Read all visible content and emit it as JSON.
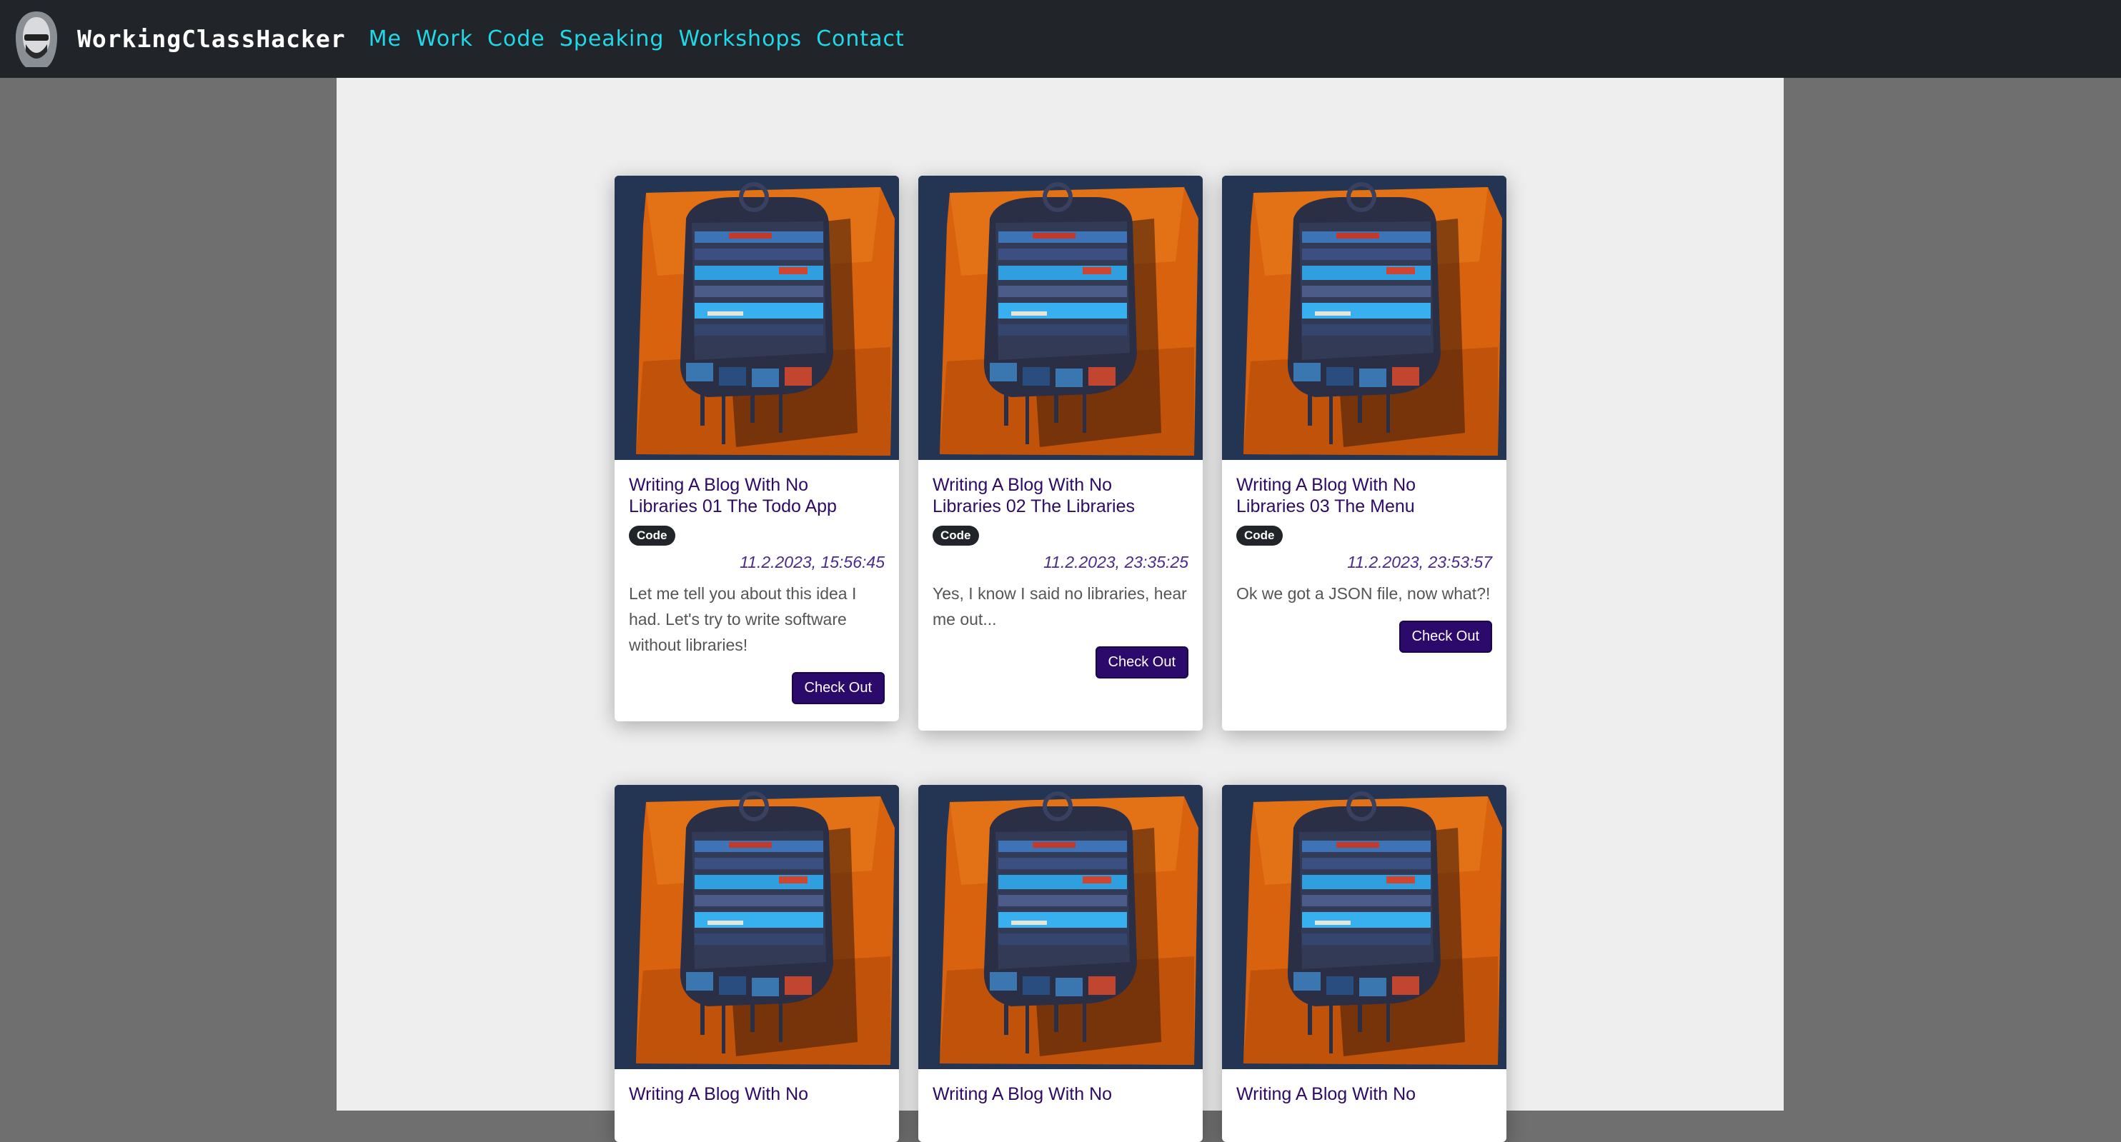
{
  "header": {
    "brand": "WorkingClassHacker",
    "logo_icon": "hooded-hacker-logo-icon",
    "nav": [
      {
        "label": "Me"
      },
      {
        "label": "Work"
      },
      {
        "label": "Code"
      },
      {
        "label": "Speaking"
      },
      {
        "label": "Workshops"
      },
      {
        "label": "Contact"
      }
    ]
  },
  "posts": [
    {
      "title_line1": "Writing A Blog With No",
      "title_line2": "Libraries 01 The Todo App",
      "tag": "Code",
      "date": "11.2.2023, 15:56:45",
      "excerpt": "Let me tell you about this idea I had. Let's try to write software without libraries!",
      "button": "Check Out"
    },
    {
      "title_line1": "Writing A Blog With No",
      "title_line2": "Libraries 02 The Libraries",
      "tag": "Code",
      "date": "11.2.2023, 23:35:25",
      "excerpt": "Yes, I know I said no libraries, hear me out...",
      "button": "Check Out"
    },
    {
      "title_line1": "Writing A Blog With No",
      "title_line2": "Libraries 03 The Menu",
      "tag": "Code",
      "date": "11.2.2023, 23:53:57",
      "excerpt": "Ok we got a JSON file, now what?!",
      "button": "Check Out"
    },
    {
      "title_line1": "Writing A Blog With No"
    },
    {
      "title_line1": "Writing A Blog With No"
    },
    {
      "title_line1": "Writing A Blog With No"
    }
  ],
  "colors": {
    "navbar_bg": "#212529",
    "nav_link": "#20d8e8",
    "title": "#2e0a66",
    "button_bg": "#2b0a6b",
    "page_bg": "#eeeeee",
    "outer_bg": "#6f6f6f"
  }
}
